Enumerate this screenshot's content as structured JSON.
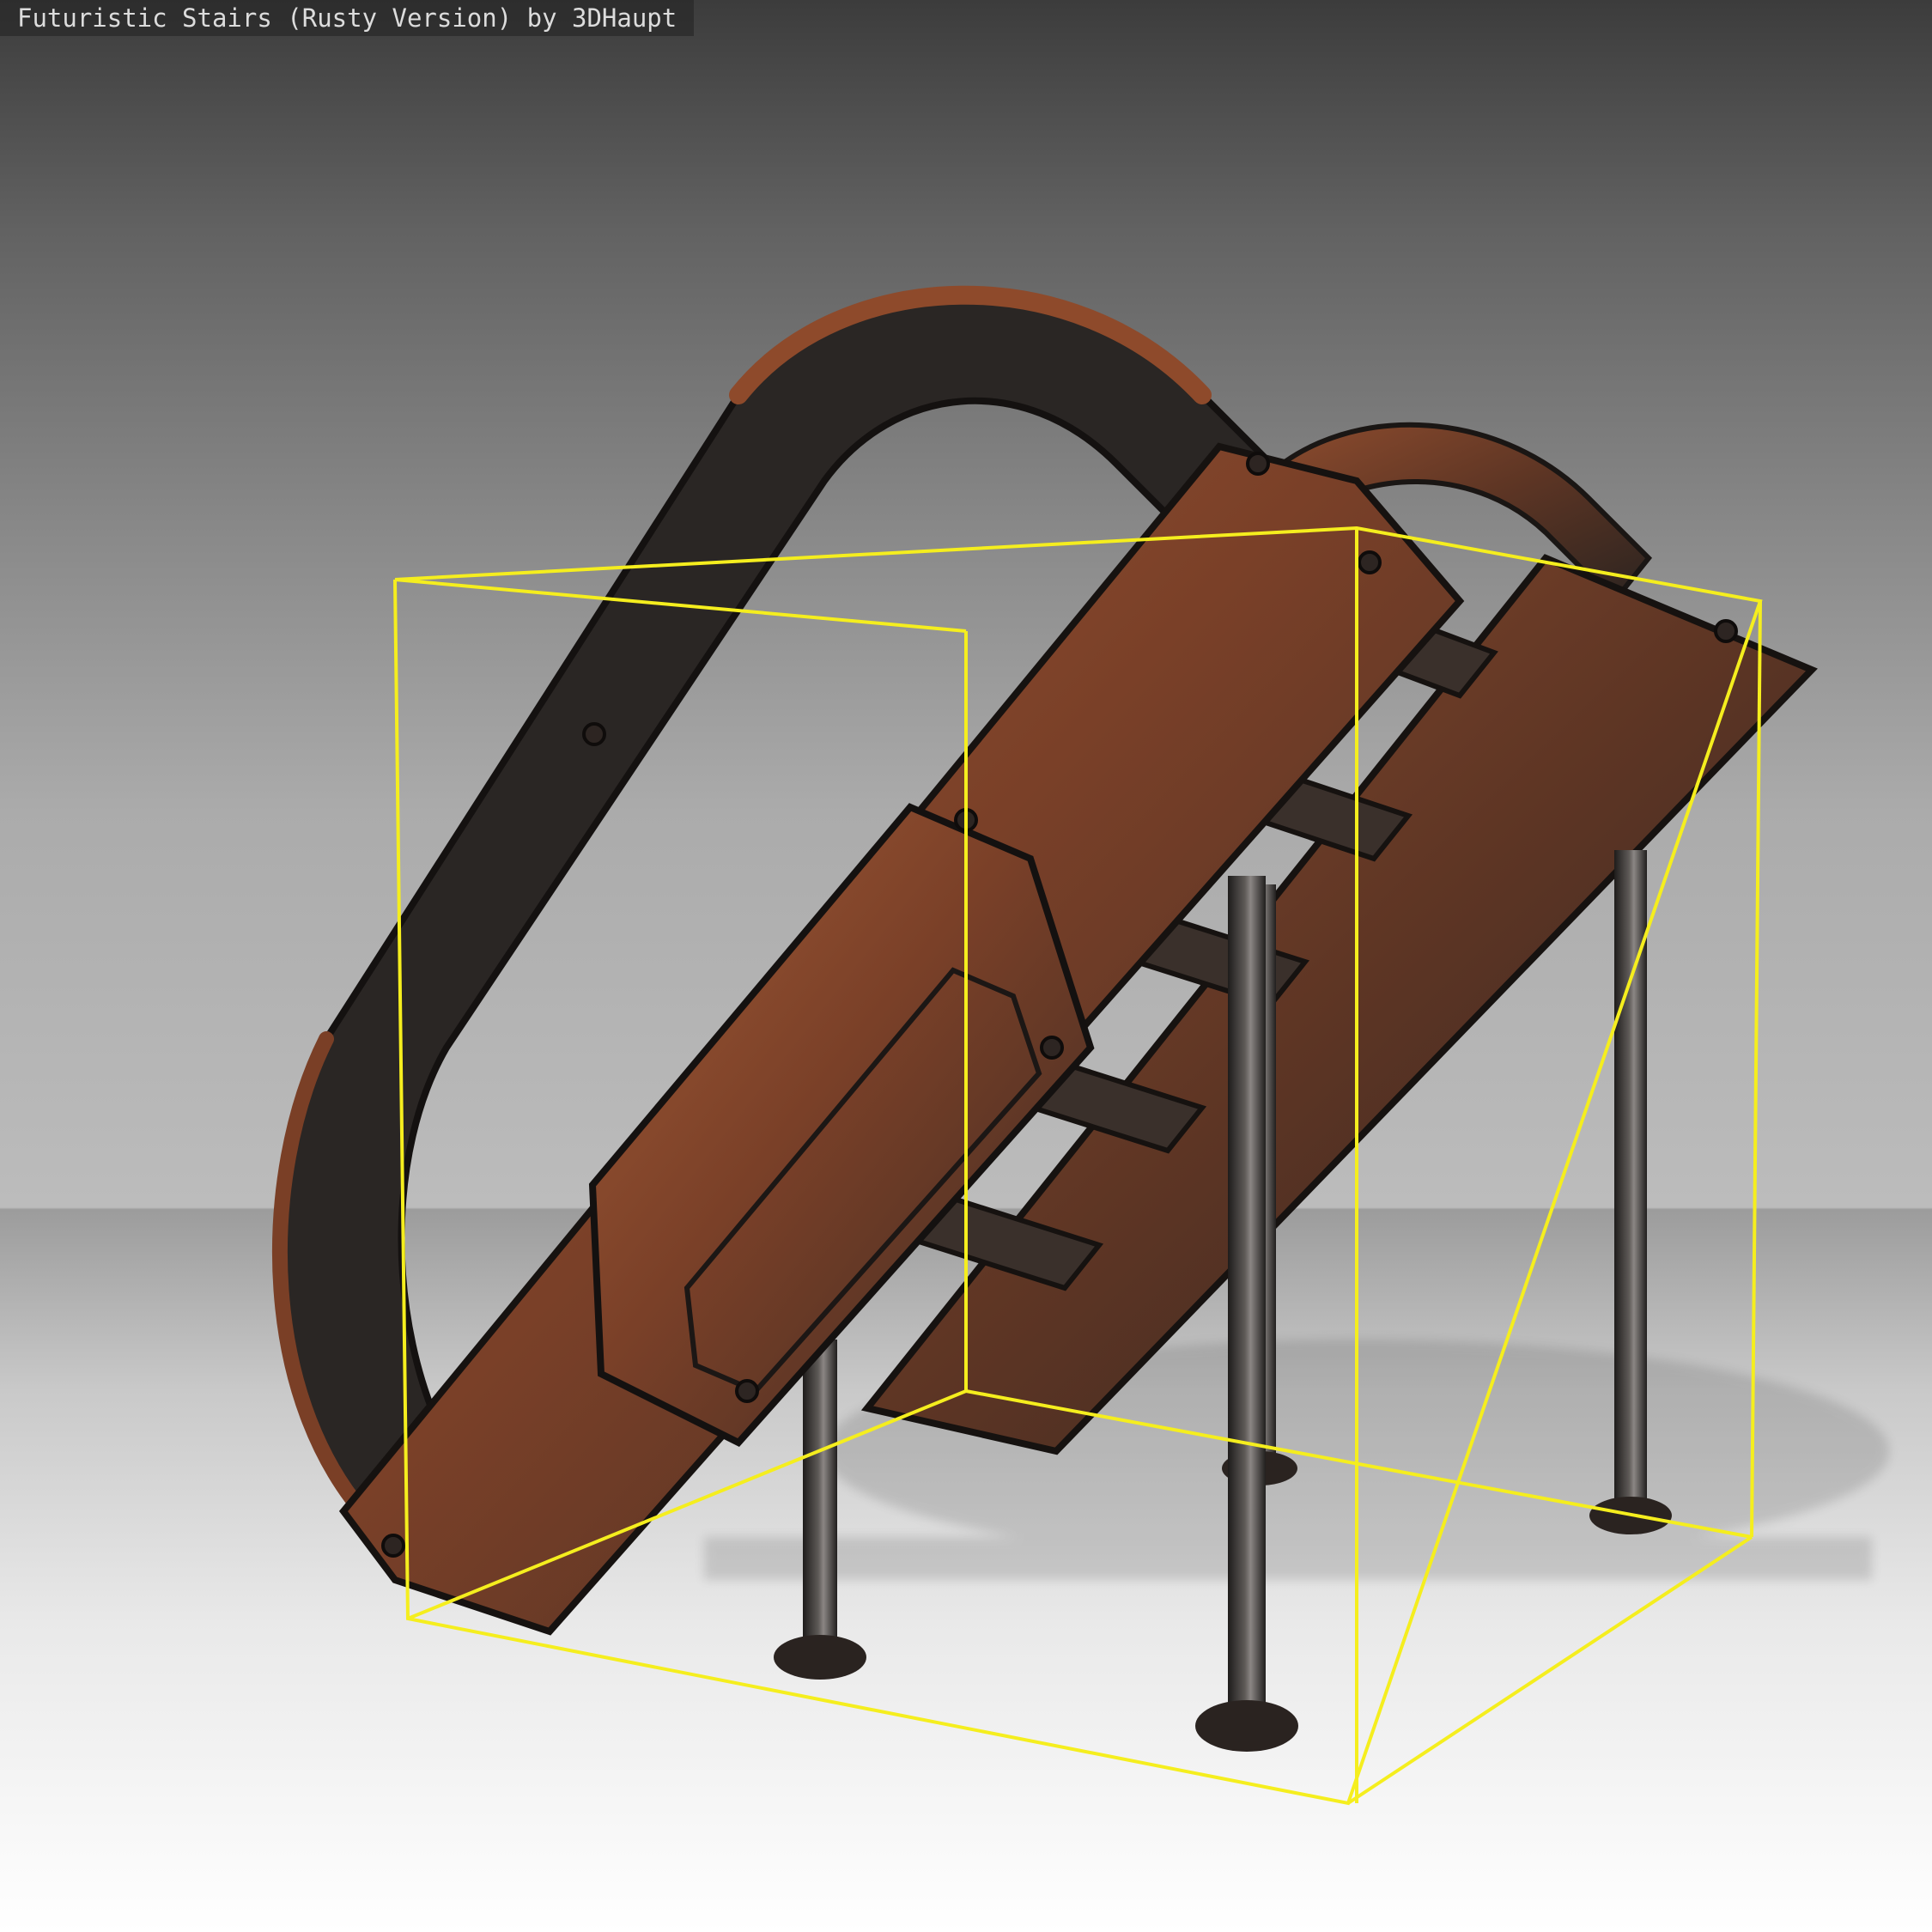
{
  "viewer": {
    "title": "Futuristic Stairs (Rusty Version) by 3DHaupt"
  },
  "scene": {
    "model": "futuristic-rusty-stairs",
    "bounding_box_color": "#f5ee1e",
    "rust_color": "#8a4a2c",
    "dark_metal_color": "#2b2522",
    "background_top": "#3c3c3c",
    "floor_color": "#ffffff"
  }
}
